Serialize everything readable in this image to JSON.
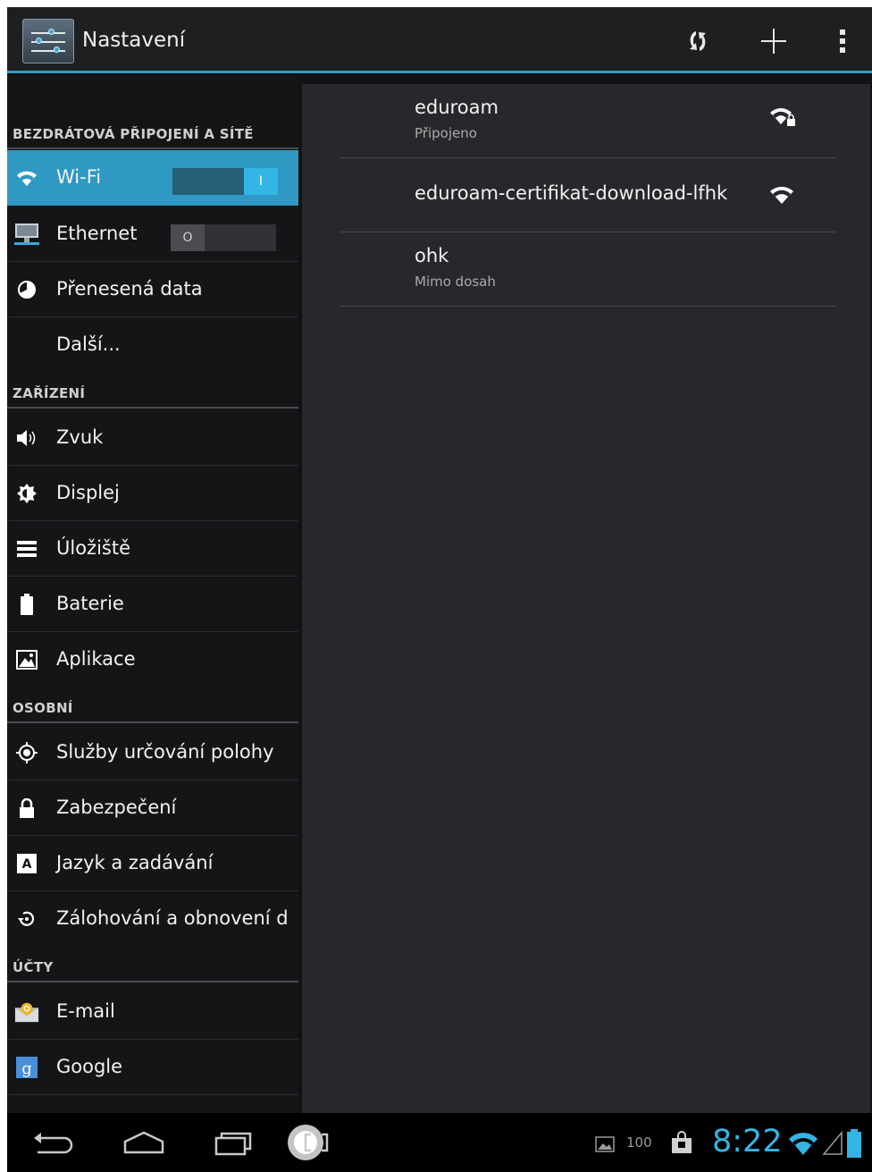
{
  "app": {
    "title": "Nastavení",
    "icon": "settings-sliders-icon"
  },
  "actionbar": {
    "icons": [
      "wps-icon",
      "add-network-icon",
      "overflow-menu-icon"
    ]
  },
  "sections": {
    "wireless": "BEZDRÁTOVÁ PŘIPOJENÍ A SÍTĚ",
    "device": "ZAŘÍZENÍ",
    "personal": "OSOBNÍ",
    "accounts": "ÚČTY"
  },
  "items": {
    "wifi": {
      "label": "Wi-Fi",
      "toggle": "I",
      "on": true
    },
    "ethernet": {
      "label": "Ethernet",
      "toggle": "O",
      "on": false
    },
    "data_usage": {
      "label": "Přenesená data"
    },
    "more": {
      "label": "Další..."
    },
    "sound": {
      "label": "Zvuk"
    },
    "display": {
      "label": "Displej"
    },
    "storage": {
      "label": "Úložiště"
    },
    "battery": {
      "label": "Baterie"
    },
    "apps": {
      "label": "Aplikace"
    },
    "location": {
      "label": "Služby určování polohy"
    },
    "security": {
      "label": "Zabezpečení"
    },
    "language": {
      "label": "Jazyk a zadávání"
    },
    "backup": {
      "label": "Zálohování a obnovení d"
    },
    "email": {
      "label": "E-mail"
    },
    "google": {
      "label": "Google"
    }
  },
  "networks": [
    {
      "name": "eduroam",
      "status": "Připojeno",
      "secured": true
    },
    {
      "name": "eduroam-certifikat-download-lfhk",
      "status": "",
      "secured": false
    },
    {
      "name": "ohk",
      "status": "Mimo dosah",
      "secured": false
    }
  ],
  "statusbar": {
    "time": "8:22",
    "battery_text": "100"
  },
  "colors": {
    "accent": "#33b5e5",
    "selected": "#2f98c3",
    "background": "#111214",
    "panel": "#27282b"
  }
}
